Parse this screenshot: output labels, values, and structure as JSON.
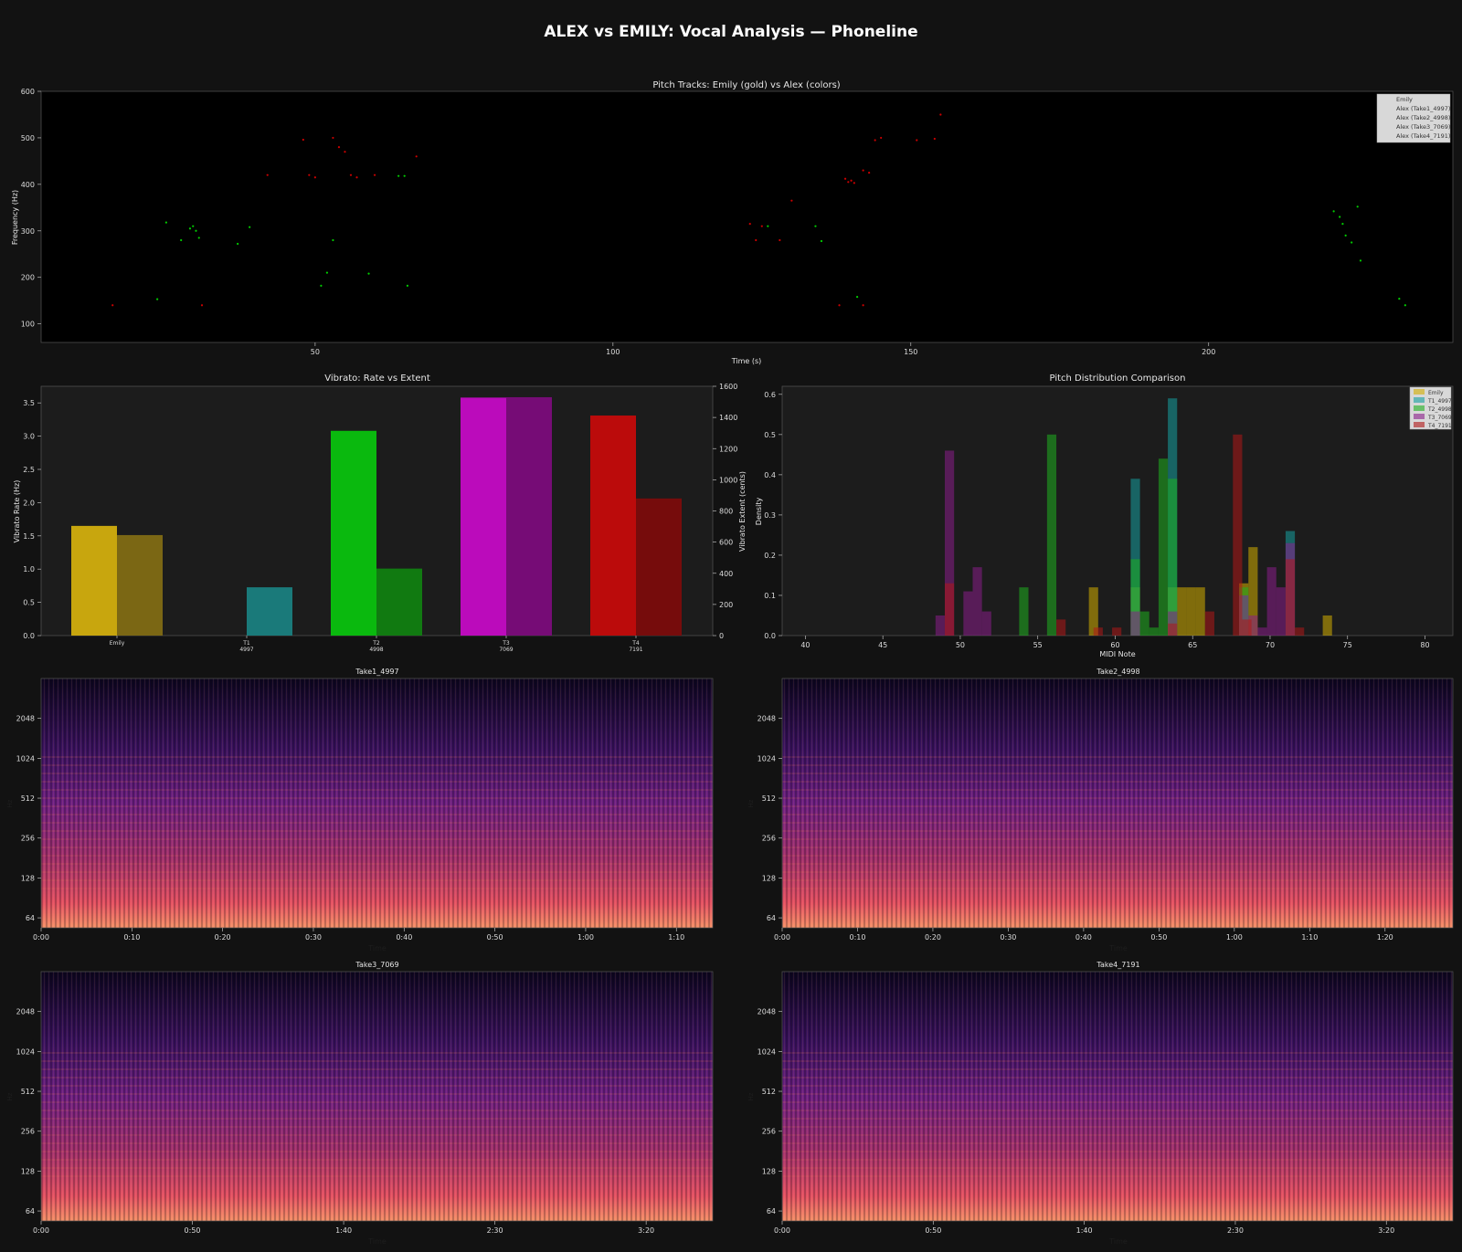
{
  "figure": {
    "title": "ALEX vs EMILY: Vocal Analysis — Phoneline",
    "background": "#121212"
  },
  "colors": {
    "emily": "#d4af00",
    "take1": "#0e8a8a",
    "take2": "#00cc00",
    "take3": "#cc00cc",
    "take4": "#cc0000"
  },
  "chart_data": [
    {
      "id": "pitch",
      "type": "scatter",
      "title": "Pitch Tracks: Emily (gold) vs Alex (colors)",
      "xlabel": "Time (s)",
      "ylabel": "Frequency (Hz)",
      "xlim": [
        4,
        241
      ],
      "ylim": [
        60,
        600
      ],
      "xticks": [
        50,
        100,
        150,
        200
      ],
      "yticks": [
        100,
        200,
        300,
        400,
        500,
        600
      ],
      "legend": {
        "position": "top-right",
        "entries": [
          "Emily",
          "Alex (Take1_4997)",
          "Alex (Take2_4998)",
          "Alex (Take3_7069)",
          "Alex (Take4_7191)"
        ]
      },
      "series": [
        {
          "name": "Alex (Take2_4998)",
          "color": "#00cc00",
          "points": [
            [
              23.5,
              153
            ],
            [
              25,
              318
            ],
            [
              27.5,
              280
            ],
            [
              29,
              305
            ],
            [
              29.5,
              310
            ],
            [
              30,
              300
            ],
            [
              30.5,
              285
            ],
            [
              37,
              272
            ],
            [
              39,
              308
            ],
            [
              51,
              182
            ],
            [
              52,
              210
            ],
            [
              53,
              280
            ],
            [
              59,
              208
            ],
            [
              64,
              418
            ],
            [
              65,
              418
            ],
            [
              65.5,
              182
            ],
            [
              126,
              310
            ],
            [
              134,
              310
            ],
            [
              135,
              278
            ],
            [
              141,
              158
            ],
            [
              221,
              342
            ],
            [
              222,
              330
            ],
            [
              222.5,
              315
            ],
            [
              223,
              290
            ],
            [
              224,
              275
            ],
            [
              225,
              352
            ],
            [
              225.5,
              236
            ],
            [
              232,
              154
            ],
            [
              233,
              140
            ]
          ]
        },
        {
          "name": "Alex (Take4_7191)",
          "color": "#cc0000",
          "points": [
            [
              16,
              140
            ],
            [
              31,
              140
            ],
            [
              42,
              420
            ],
            [
              48,
              496
            ],
            [
              49,
              420
            ],
            [
              50,
              415
            ],
            [
              53,
              500
            ],
            [
              54,
              480
            ],
            [
              55,
              470
            ],
            [
              56,
              420
            ],
            [
              57,
              415
            ],
            [
              60,
              420
            ],
            [
              67,
              460
            ],
            [
              123,
              315
            ],
            [
              124,
              280
            ],
            [
              125,
              310
            ],
            [
              128,
              280
            ],
            [
              130,
              365
            ],
            [
              138,
              140
            ],
            [
              139,
              412
            ],
            [
              139.5,
              405
            ],
            [
              140,
              408
            ],
            [
              140.5,
              403
            ],
            [
              142,
              430
            ],
            [
              143,
              425
            ],
            [
              144,
              495
            ],
            [
              145,
              500
            ],
            [
              151,
              495
            ],
            [
              154,
              498
            ],
            [
              155,
              550
            ],
            [
              142,
              140
            ]
          ]
        }
      ]
    },
    {
      "id": "vibrato",
      "type": "bar",
      "title": "Vibrato: Rate vs Extent",
      "ylabel": "Vibrato Rate (Hz)",
      "y2label": "Vibrato Extent (cents)",
      "categories": [
        "Emily",
        "T1\n4997",
        "T2\n4998",
        "T3\n7069",
        "T4\n7191"
      ],
      "ylim": [
        0,
        3.75
      ],
      "y2lim": [
        0,
        1600
      ],
      "yticks": [
        0.0,
        0.5,
        1.0,
        1.5,
        2.0,
        2.5,
        3.0,
        3.5
      ],
      "y2ticks": [
        0,
        200,
        400,
        600,
        800,
        1000,
        1200,
        1400,
        1600
      ],
      "series": [
        {
          "name": "Vibrato Rate (Hz)",
          "values": [
            1.65,
            0.0,
            3.08,
            3.58,
            3.31
          ],
          "colors": [
            "#c8a60e",
            "#0e8a8a",
            "#0ab90e",
            "#bb0bbb",
            "#bb0b0b"
          ]
        },
        {
          "name": "Vibrato Extent (cents)",
          "values": [
            645,
            310,
            430,
            1530,
            880
          ],
          "colors": [
            "#7b6714",
            "#1a7a7a",
            "#117a11",
            "#760c76",
            "#760c0c"
          ]
        }
      ]
    },
    {
      "id": "dist",
      "type": "bar",
      "title": "Pitch Distribution Comparison",
      "xlabel": "MIDI Note",
      "ylabel": "Density",
      "xlim": [
        38.5,
        81.8
      ],
      "ylim": [
        0,
        0.62
      ],
      "xticks": [
        40,
        45,
        50,
        55,
        60,
        65,
        70,
        75,
        80
      ],
      "yticks": [
        0.0,
        0.1,
        0.2,
        0.3,
        0.4,
        0.5,
        0.6
      ],
      "bin_width": 0.6,
      "legend": {
        "position": "top-right",
        "entries": [
          "Emily",
          "T1_4997",
          "T2_4998",
          "T3_7069",
          "T4_7191"
        ]
      },
      "series": [
        {
          "name": "Emily",
          "color": "#d4af00",
          "bins": [
            [
              58.3,
              0.12
            ],
            [
              61.0,
              0.12
            ],
            [
              63.4,
              0.12
            ],
            [
              64.0,
              0.12
            ],
            [
              64.6,
              0.12
            ],
            [
              65.2,
              0.12
            ],
            [
              68.0,
              0.13
            ],
            [
              68.6,
              0.22
            ],
            [
              73.4,
              0.05
            ]
          ]
        },
        {
          "name": "T1_4997",
          "color": "#16a0a0",
          "bins": [
            [
              61.0,
              0.39
            ],
            [
              63.4,
              0.59
            ],
            [
              68.0,
              0.1
            ],
            [
              71.0,
              0.26
            ]
          ]
        },
        {
          "name": "T2_4998",
          "color": "#1fb01f",
          "bins": [
            [
              53.8,
              0.12
            ],
            [
              55.6,
              0.5
            ],
            [
              61.0,
              0.19
            ],
            [
              61.6,
              0.06
            ],
            [
              62.2,
              0.02
            ],
            [
              62.8,
              0.44
            ],
            [
              63.4,
              0.39
            ],
            [
              68.0,
              0.12
            ]
          ]
        },
        {
          "name": "T3_7069",
          "color": "#8a1e8a",
          "bins": [
            [
              48.4,
              0.05
            ],
            [
              49.0,
              0.46
            ],
            [
              50.2,
              0.11
            ],
            [
              50.8,
              0.17
            ],
            [
              51.4,
              0.06
            ],
            [
              61.0,
              0.06
            ],
            [
              63.4,
              0.06
            ],
            [
              68.0,
              0.1
            ],
            [
              68.6,
              0.05
            ],
            [
              69.2,
              0.02
            ],
            [
              69.8,
              0.17
            ],
            [
              70.4,
              0.12
            ],
            [
              71.0,
              0.23
            ]
          ]
        },
        {
          "name": "T4_7191",
          "color": "#b01818",
          "bins": [
            [
              49.0,
              0.13
            ],
            [
              56.2,
              0.04
            ],
            [
              58.6,
              0.02
            ],
            [
              59.8,
              0.02
            ],
            [
              63.4,
              0.03
            ],
            [
              65.8,
              0.06
            ],
            [
              67.6,
              0.5
            ],
            [
              68.2,
              0.04
            ],
            [
              71.0,
              0.19
            ],
            [
              71.6,
              0.02
            ]
          ]
        }
      ]
    },
    {
      "id": "spec1",
      "type": "heatmap",
      "title": "Take1_4997",
      "xlabel": "Time",
      "ylabel": "Hz",
      "xticks": [
        "0:00",
        "0:10",
        "0:20",
        "0:30",
        "0:40",
        "0:50",
        "1:00",
        "1:10"
      ],
      "duration_s": 74,
      "yticks": [
        "64",
        "128",
        "256",
        "512",
        "1024",
        "2048"
      ],
      "colormap": "magma"
    },
    {
      "id": "spec2",
      "type": "heatmap",
      "title": "Take2_4998",
      "xlabel": "Time",
      "ylabel": "Hz",
      "xticks": [
        "0:00",
        "0:10",
        "0:20",
        "0:30",
        "0:40",
        "0:50",
        "1:00",
        "1:10",
        "1:20"
      ],
      "duration_s": 89,
      "yticks": [
        "64",
        "128",
        "256",
        "512",
        "1024",
        "2048"
      ],
      "colormap": "magma"
    },
    {
      "id": "spec3",
      "type": "heatmap",
      "title": "Take3_7069",
      "xlabel": "Time",
      "ylabel": "Hz",
      "xticks": [
        "0:00",
        "0:50",
        "1:40",
        "2:30",
        "3:20"
      ],
      "duration_s": 222,
      "yticks": [
        "64",
        "128",
        "256",
        "512",
        "1024",
        "2048"
      ],
      "colormap": "magma"
    },
    {
      "id": "spec4",
      "type": "heatmap",
      "title": "Take4_7191",
      "xlabel": "Time",
      "ylabel": "Hz",
      "xticks": [
        "0:00",
        "0:50",
        "1:40",
        "2:30",
        "3:20"
      ],
      "duration_s": 222,
      "yticks": [
        "64",
        "128",
        "256",
        "512",
        "1024",
        "2048"
      ],
      "colormap": "magma"
    }
  ]
}
